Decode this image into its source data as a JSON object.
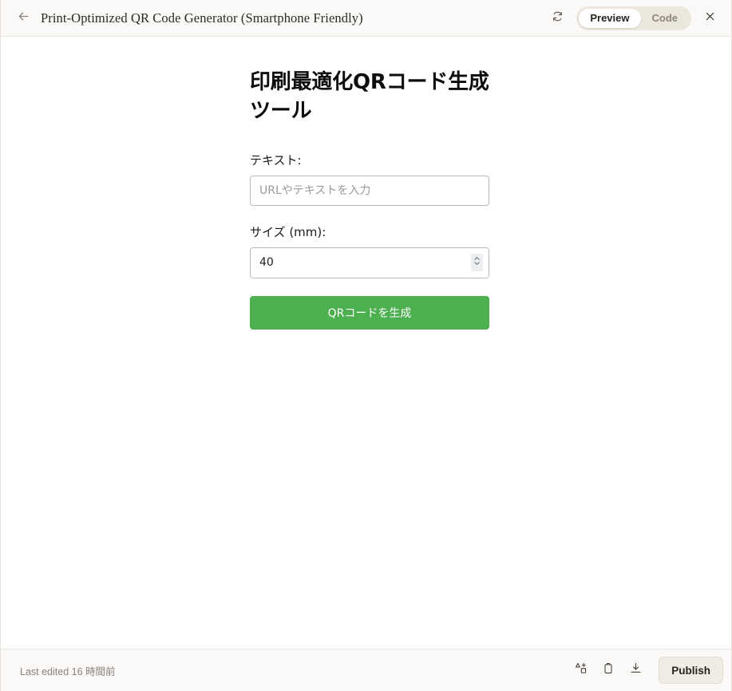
{
  "topbar": {
    "back_icon": "arrow-left-icon",
    "title": "Print-Optimized QR Code Generator (Smartphone Friendly)",
    "refresh_icon": "refresh-icon",
    "close_icon": "close-icon",
    "view_toggle": {
      "options": [
        "Preview",
        "Code"
      ],
      "selected": "Preview",
      "preview_label": "Preview",
      "code_label": "Code"
    }
  },
  "main": {
    "heading": "印刷最適化QRコード生成ツール",
    "text_field": {
      "label": "テキスト:",
      "value": "",
      "placeholder": "URLやテキストを入力"
    },
    "size_field": {
      "label": "サイズ (mm):",
      "value": "40",
      "placeholder": "",
      "spinner_icon": "spinner-up-down-icon"
    },
    "generate_button": {
      "label": "QRコードを生成",
      "color": "#4caf50"
    }
  },
  "bottombar": {
    "last_edited": "Last edited 16 時間前",
    "icons": [
      {
        "name": "add-shape-icon"
      },
      {
        "name": "clipboard-icon"
      },
      {
        "name": "download-icon"
      }
    ],
    "publish_label": "Publish"
  },
  "colors": {
    "accent_green": "#4caf50",
    "chrome_bg": "#faf9f7",
    "toggle_bg": "#ece7dd",
    "content_bg": "#ffffff"
  }
}
